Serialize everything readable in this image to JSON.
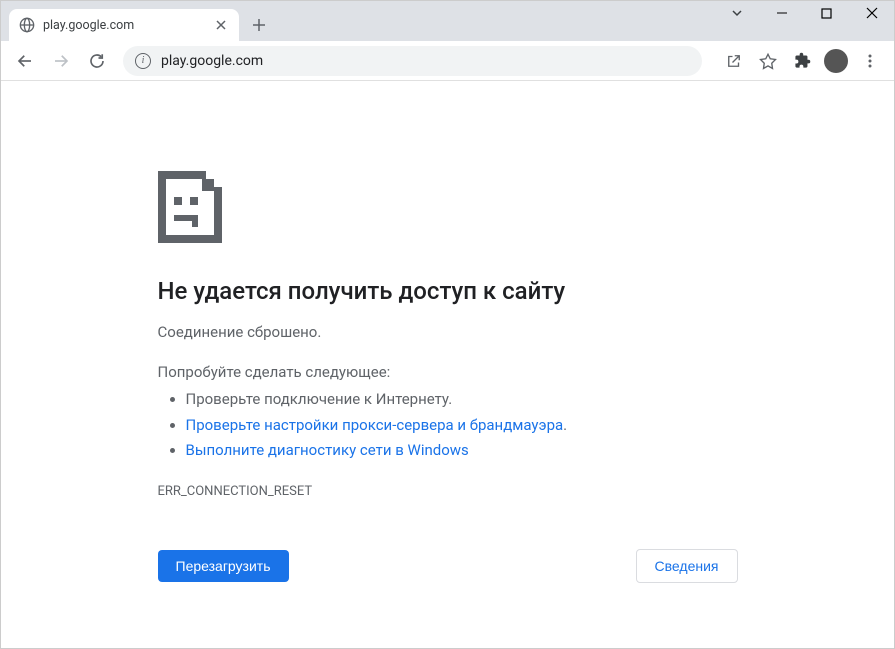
{
  "window": {
    "tab_title": "play.google.com"
  },
  "toolbar": {
    "url": "play.google.com"
  },
  "error": {
    "title": "Не удается получить доступ к сайту",
    "subtitle": "Соединение сброшено.",
    "suggest": "Попробуйте сделать следующее:",
    "items": [
      "Проверьте подключение к Интернету.",
      "Проверьте настройки прокси-сервера и брандмауэра",
      "Выполните диагностику сети в Windows"
    ],
    "code": "ERR_CONNECTION_RESET",
    "reload": "Перезагрузить",
    "details": "Сведения"
  }
}
